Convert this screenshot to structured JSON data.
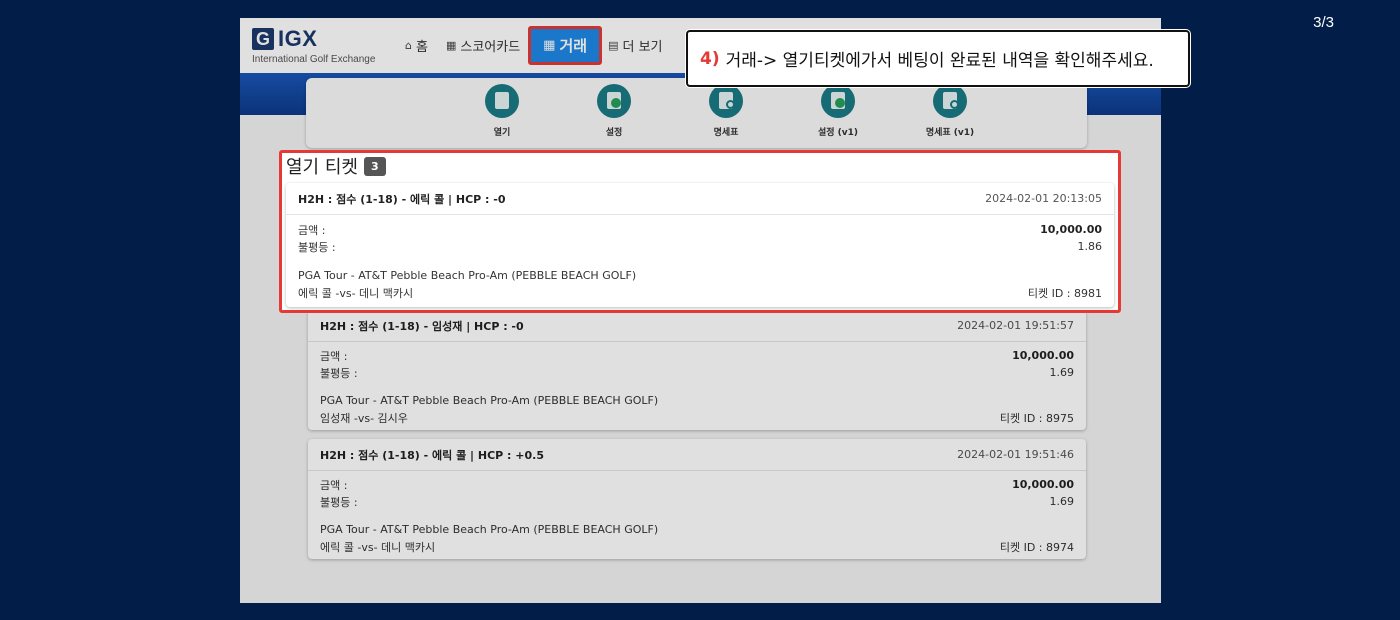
{
  "page_counter": "3/3",
  "header": {
    "logo_text": "IGX",
    "logo_subtitle": "International Golf Exchange",
    "nav": [
      {
        "label": "홈",
        "icon": "home-icon"
      },
      {
        "label": "스코어카드",
        "icon": "table-icon"
      },
      {
        "label": "거래",
        "icon": "calculator-icon",
        "active": true
      },
      {
        "label": "더 보기",
        "icon": "list-icon"
      }
    ]
  },
  "subnav": [
    {
      "label": "열기",
      "icon": "ticket-icon"
    },
    {
      "label": "설정",
      "icon": "check-ticket-icon"
    },
    {
      "label": "명세표",
      "icon": "statement-icon"
    },
    {
      "label": "설정 (v1)",
      "icon": "check-ticket-icon"
    },
    {
      "label": "명세표 (v1)",
      "icon": "statement-icon"
    }
  ],
  "tickets_section": {
    "title": "열기 티켓",
    "count": "3"
  },
  "tickets": [
    {
      "match": "H2H : 점수 (1-18) - 에릭 콜 | HCP : -0",
      "time": "2024-02-01 20:13:05",
      "amount_label": "금액 :",
      "amount_value": "10,000.00",
      "odds_label": "불평등 :",
      "odds_value": "1.86",
      "tour": "PGA Tour - AT&T Pebble Beach Pro-Am (PEBBLE BEACH GOLF)",
      "players": "에릭 콜 -vs- 데니 맥카시",
      "ticket_id": "티켓 ID : 8981"
    },
    {
      "match": "H2H : 점수 (1-18) - 임성재 | HCP : -0",
      "time": "2024-02-01 19:51:57",
      "amount_label": "금액 :",
      "amount_value": "10,000.00",
      "odds_label": "불평등 :",
      "odds_value": "1.69",
      "tour": "PGA Tour - AT&T Pebble Beach Pro-Am (PEBBLE BEACH GOLF)",
      "players": "임성재 -vs- 김시우",
      "ticket_id": "티켓 ID : 8975"
    },
    {
      "match": "H2H : 점수 (1-18) - 에릭 콜 | HCP : +0.5",
      "time": "2024-02-01 19:51:46",
      "amount_label": "금액 :",
      "amount_value": "10,000.00",
      "odds_label": "불평등 :",
      "odds_value": "1.69",
      "tour": "PGA Tour - AT&T Pebble Beach Pro-Am (PEBBLE BEACH GOLF)",
      "players": "에릭 콜 -vs- 데니 맥카시",
      "ticket_id": "티켓 ID : 8974"
    }
  ],
  "callout": {
    "step": "4)",
    "text": "거래-> 열기티켓에가서 베팅이 완료된 내역을 확인해주세요."
  },
  "colors": {
    "background": "#011d48",
    "accent": "#1e88e5",
    "highlight": "#e53935",
    "brand": "#1c3a6e"
  }
}
